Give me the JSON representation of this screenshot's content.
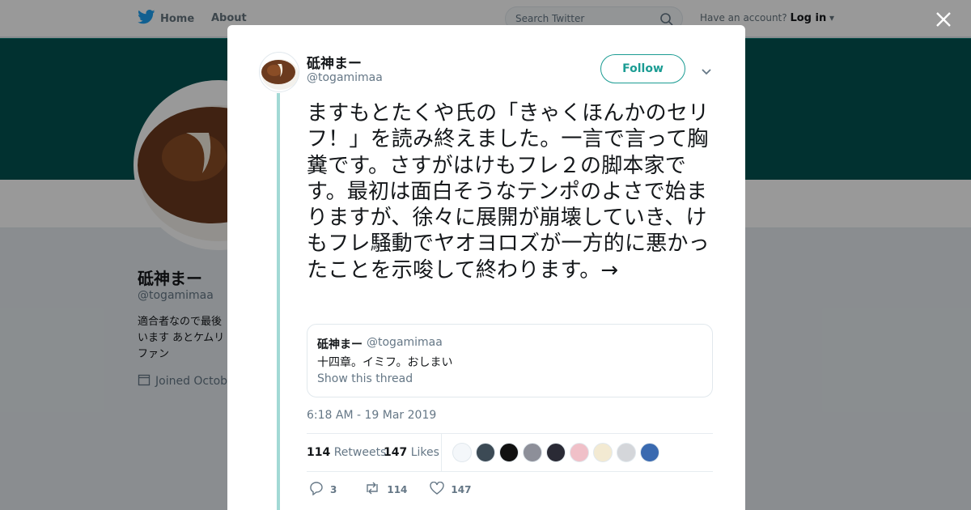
{
  "topbar": {
    "home_label": "Home",
    "about_label": "About",
    "search_placeholder": "Search Twitter",
    "account_prompt": "Have an account?",
    "login_label": "Log in"
  },
  "profile": {
    "name": "砥神まー",
    "handle": "@togamimaa",
    "bio": "適合者なので最後 います あとケムリ ファン",
    "joined": "Joined Octobe"
  },
  "tweet": {
    "author_name": "砥神まー",
    "author_handle": "@togamimaa",
    "follow_label": "Follow",
    "text": "ますもとたくや氏の「きゃくほんかのセリフ！」を読み終えました。一言で言って胸糞です。さすがはけもフレ２の脚本家です。最初は面白そうなテンポのよさで始まりますが、徐々に展開が崩壊していき、けもフレ騒動でヤオヨロズが一方的に悪かったことを示唆して終わります。→",
    "quote": {
      "name": "砥神まー",
      "handle": "@togamimaa",
      "text": "十四章。イミフ。おしまい",
      "link_label": "Show this thread"
    },
    "timestamp": "6:18 AM - 19 Mar 2019",
    "retweets_count": "114",
    "retweets_label": "Retweets",
    "likes_count": "147",
    "likes_label": "Likes",
    "reply_count": "3",
    "retweet_action_count": "114",
    "like_action_count": "147"
  },
  "colors": {
    "accent": "#1b9c93",
    "banner": "#035350",
    "thread_line": "#a2d9d5"
  },
  "icons": [
    "twitter-bird-icon",
    "search-icon",
    "calendar-icon",
    "close-icon",
    "chevron-down-icon",
    "reply-icon",
    "retweet-icon",
    "heart-icon"
  ]
}
